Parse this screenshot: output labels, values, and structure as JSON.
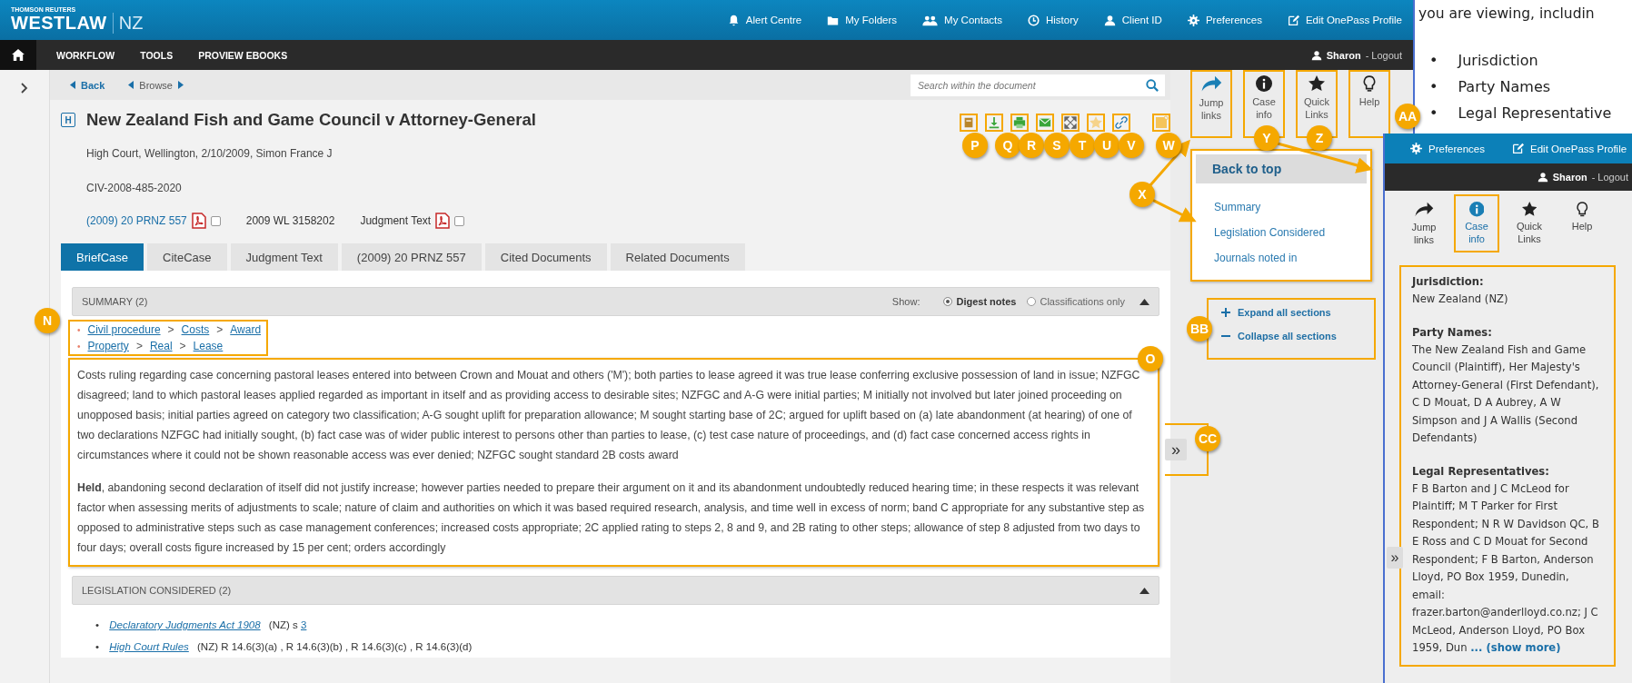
{
  "header": {
    "brand_small": "THOMSON REUTERS",
    "brand": "WESTLAW",
    "region": "NZ",
    "links": [
      "Alert Centre",
      "My Folders",
      "My Contacts",
      "History",
      "Client ID",
      "Preferences",
      "Edit OnePass Profile"
    ]
  },
  "nav": {
    "items": [
      "WORKFLOW",
      "TOOLS",
      "PROVIEW EBOOKS"
    ],
    "user": "Sharon",
    "logout": "- Logout"
  },
  "doc_bar": {
    "back": "Back",
    "browse": "Browse",
    "search": {
      "placeholder": "Search within the document"
    }
  },
  "document": {
    "badge": "H",
    "title": "New Zealand Fish and Game Council v Attorney-General",
    "court": "High Court, Wellington, 2/10/2009, Simon France J",
    "file_no": "CIV-2008-485-2020",
    "citations": [
      {
        "text": "(2009) 20 PRNZ 557",
        "kind": "link",
        "pdf": {
          "checked": false
        }
      },
      {
        "text": "2009 WL 3158202",
        "kind": "plain"
      },
      {
        "text": "Judgment Text",
        "kind": "plain",
        "pdf": {
          "checked": false
        }
      }
    ]
  },
  "tabs": [
    {
      "label": "BriefCase",
      "selected": true
    },
    {
      "label": "CiteCase",
      "selected": false
    },
    {
      "label": "Judgment Text",
      "selected": false
    },
    {
      "label": "(2009) 20 PRNZ 557",
      "selected": false
    },
    {
      "label": "Cited Documents",
      "selected": false
    },
    {
      "label": "Related Documents",
      "selected": false
    }
  ],
  "summary": {
    "title": "SUMMARY (2)",
    "expanded": true,
    "show_label": "Show:",
    "options": [
      {
        "label": "Digest notes",
        "selected": true
      },
      {
        "label": "Classifications only",
        "selected": false
      }
    ],
    "classifications": [
      [
        "Civil procedure",
        "Costs",
        "Award"
      ],
      [
        "Property",
        "Real",
        "Lease"
      ]
    ],
    "separator": ">",
    "marker": "•",
    "paragraphs": [
      "Costs ruling regarding case concerning pastoral leases entered into between Crown and Mouat and others ('M'); both parties to lease agreed it was true lease conferring exclusive possession of land in issue; NZFGC disagreed; land to which pastoral leases applied regarded as important in itself and as providing access to desirable sites; NZFGC and A-G were initial parties; M initially not involved but later joined proceeding on unopposed basis; initial parties agreed on category two classification; A-G sought uplift for preparation allowance; M sought starting base of 2C; argued for uplift based on (a) late abandonment (at hearing) of one of two declarations NZFGC had initially sought, (b) fact case was of wider public interest to persons other than parties to lease, (c) test case nature of proceedings, and (d) fact case concerned access rights in circumstances where it could not be shown reasonable access was ever denied; NZFGC sought standard 2B costs award",
      "**Held**, abandoning second declaration of itself did not justify increase; however parties needed to prepare their argument on it and its abandonment undoubtedly reduced hearing time; in these respects it was relevant factor when assessing merits of adjustments to scale; nature of claim and authorities on which it was based required research, analysis, and time well in excess of norm; band C appropriate for any substantive step as opposed to administrative steps such as case management conferences; increased costs appropriate; 2C applied rating to steps 2, 8 and 9, and 2B rating to other steps; allowance of step 8 adjusted from two days to four days; overall costs figure increased by 15 per cent; orders accordingly"
    ]
  },
  "legislation": {
    "title": "LEGISLATION CONSIDERED (2)",
    "expanded": true,
    "marker": "•",
    "items": [
      {
        "link": "Declaratory Judgments Act 1908",
        "text": "(NZ) s",
        "ref": "3"
      },
      {
        "link": "High Court Rules",
        "text": "(NZ) R 14.6(3)(a) , R 14.6(3)(b) , R 14.6(3)(c) , R 14.6(3)(d)"
      }
    ]
  },
  "side_tools": [
    {
      "label": "Jump links"
    },
    {
      "label": "Case info"
    },
    {
      "label": "Quick Links"
    },
    {
      "label": "Help"
    }
  ],
  "jump_menu": {
    "title": "Back to top",
    "items": [
      "Summary",
      "Legislation Considered",
      "Journals noted in"
    ]
  },
  "section_controls": [
    {
      "kind": "expand",
      "label": "Expand all sections"
    },
    {
      "kind": "collapse",
      "label": "Collapse all sections"
    }
  ],
  "side_collapse": "»",
  "slide": {
    "intro": "you are viewing, includin",
    "marker": "•",
    "bullets": [
      "Jurisdiction",
      "Party Names",
      "Legal Representative"
    ]
  },
  "inset": {
    "links": [
      "Preferences",
      "Edit OnePass Profile"
    ],
    "user": "Sharon",
    "logout": "- Logout",
    "tools": [
      {
        "label": "Jump links",
        "selected": false
      },
      {
        "label": "Case info",
        "selected": true
      },
      {
        "label": "Quick Links",
        "selected": false
      },
      {
        "label": "Help",
        "selected": false
      }
    ],
    "info": [
      {
        "heading": "Jurisdiction:",
        "text": "New Zealand (NZ)"
      },
      {
        "heading": "Party Names:",
        "text": "The New Zealand Fish and Game Council (Plaintiff), Her Majesty's Attorney-General (First Defendant), C D Mouat, D A Aubrey, A W Simpson and J A Wallis (Second Defendants)"
      },
      {
        "heading": "Legal Representatives:",
        "text": "F B Barton and J C McLeod for Plaintiff; M T Parker for First Respondent; N R W Davidson QC, B E Ross and C D Mouat for Second Respondent; F B Barton, Anderson Lloyd, PO Box 1959, Dunedin, email: frazer.barton@anderlloyd.co.nz; J C McLeod, Anderson Lloyd, PO Box 1959, Dun"
      }
    ],
    "more": "... (show more)",
    "collapse": "»"
  },
  "callouts": [
    "P",
    "Q",
    "R",
    "S",
    "T",
    "U",
    "V",
    "W",
    "X",
    "Y",
    "Z",
    "AA",
    "N",
    "O",
    "BB",
    "CC"
  ]
}
